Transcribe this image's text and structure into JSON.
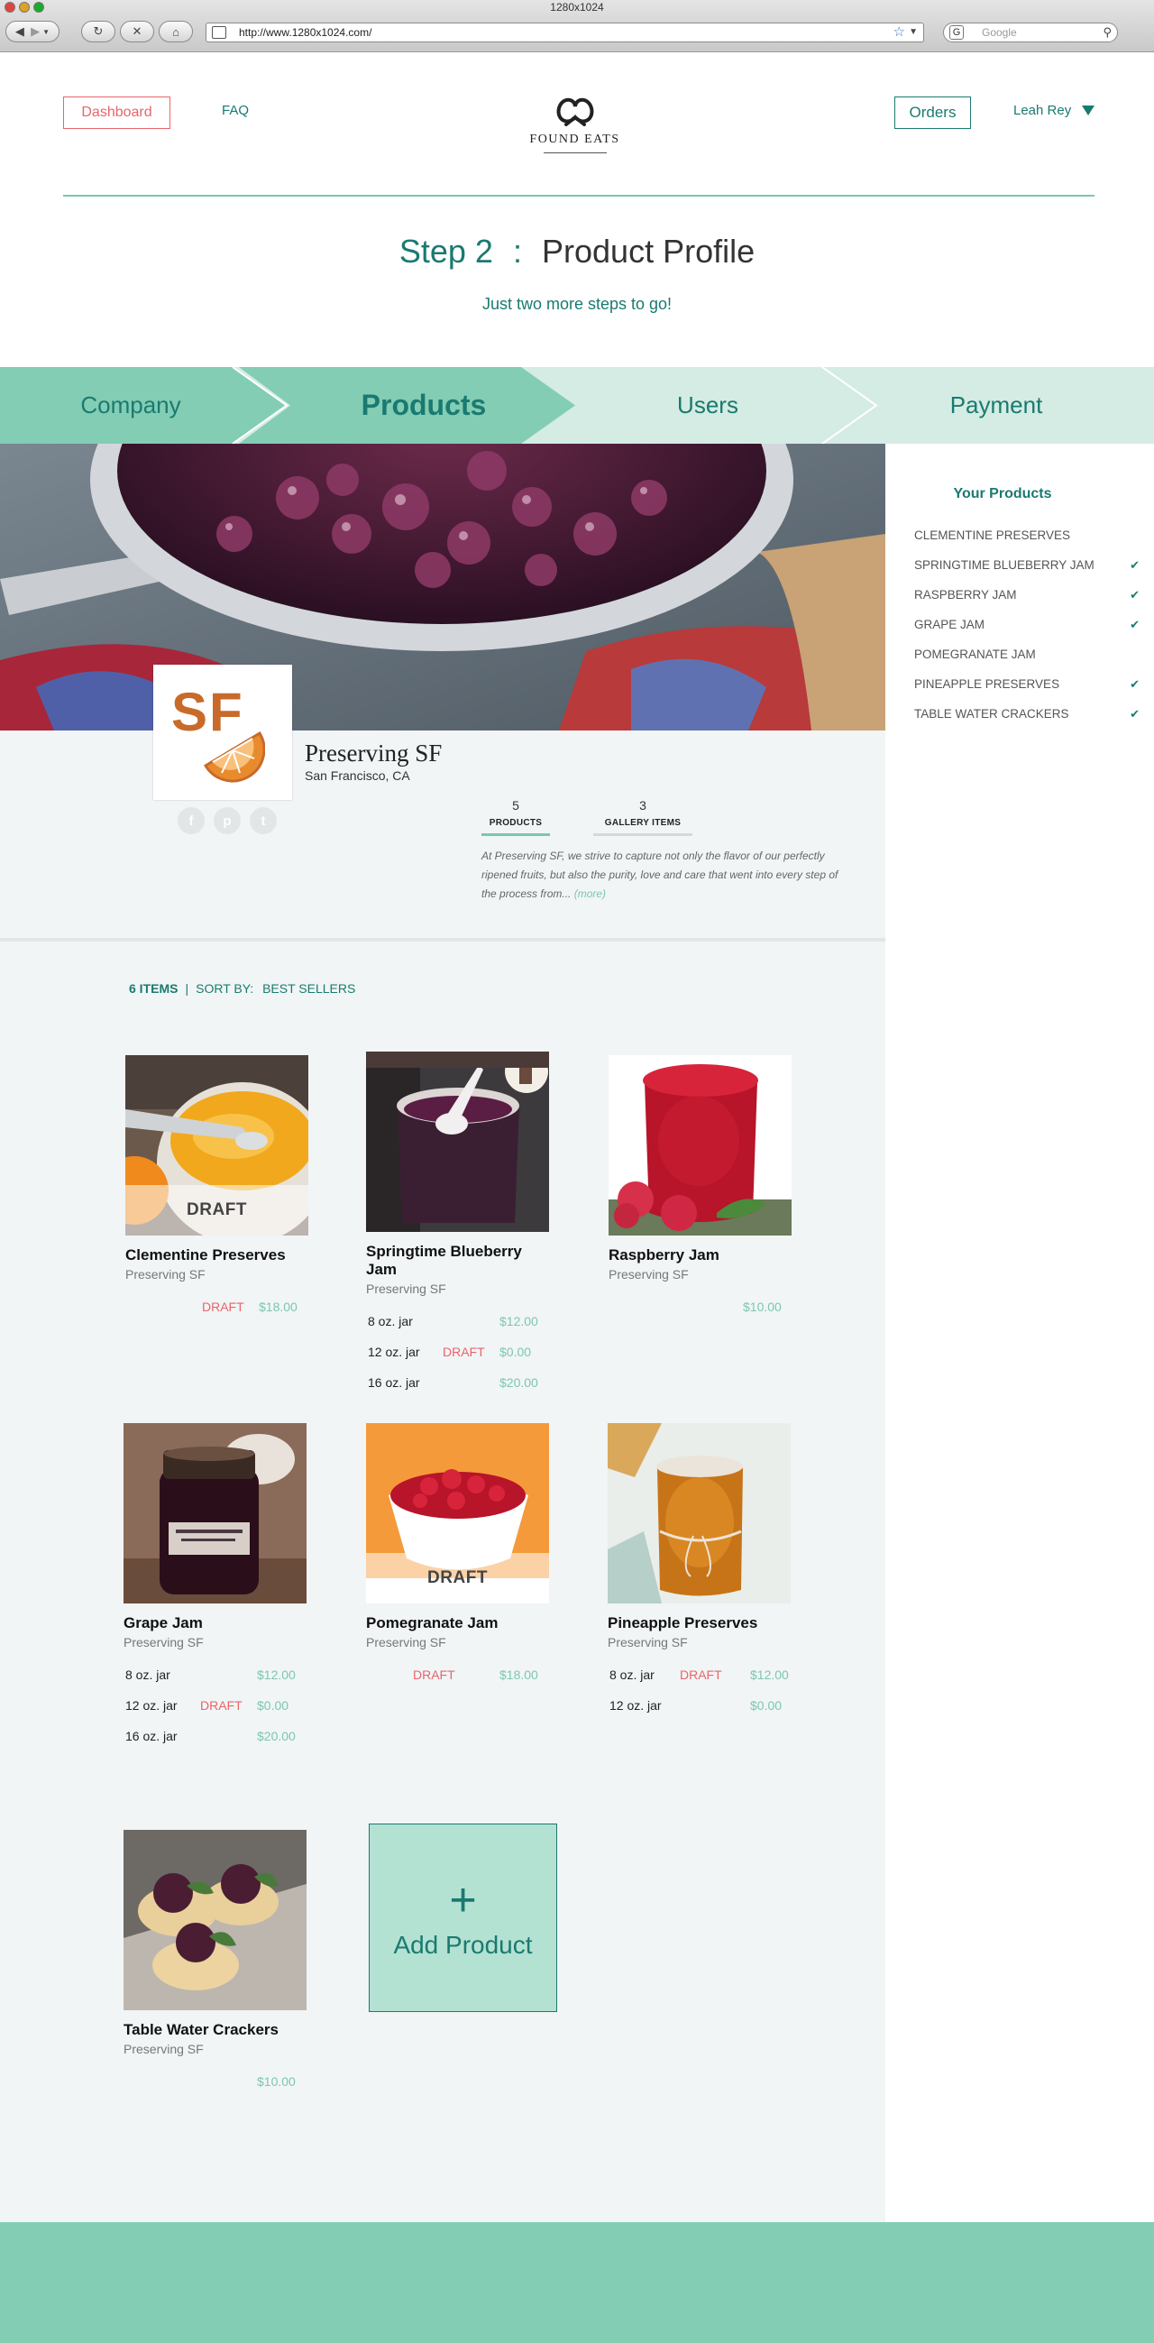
{
  "browser": {
    "window_title": "1280x1024",
    "url": "http://www.1280x1024.com/",
    "search_placeholder": "Google"
  },
  "header": {
    "dashboard_label": "Dashboard",
    "faq_label": "FAQ",
    "brand": "FOUND EATS",
    "orders_label": "Orders",
    "user_name": "Leah Rey"
  },
  "step": {
    "number": "Step 2",
    "separator": ":",
    "name": "Product Profile",
    "subtitle": "Just two more steps to go!"
  },
  "progress": {
    "steps": [
      "Company",
      "Products",
      "Users",
      "Payment"
    ],
    "active_index": 1
  },
  "profile": {
    "logo_text": "SF",
    "company": "Preserving SF",
    "city": "San Francisco, CA",
    "socials": [
      "f",
      "p",
      "t"
    ],
    "stats": [
      {
        "count": "5",
        "label": "PRODUCTS"
      },
      {
        "count": "3",
        "label": "GALLERY ITEMS"
      }
    ],
    "about": "At Preserving SF, we strive to capture not only the flavor of our perfectly ripened fruits, but also the purity, love and care that went into every step of the process from...",
    "more": "(more)"
  },
  "listing": {
    "count_label": "6 ITEMS",
    "sort_label": "SORT BY:",
    "sort_value": "BEST SELLERS"
  },
  "products": [
    {
      "title": "Clementine Preserves",
      "vendor": "Preserving SF",
      "overlay": "DRAFT",
      "rows": [
        {
          "size": "",
          "draft": "DRAFT",
          "price": "$18.00"
        }
      ]
    },
    {
      "title": "Springtime Blueberry Jam",
      "vendor": "Preserving SF",
      "overlay": "",
      "rows": [
        {
          "size": "8 oz.  jar",
          "draft": "",
          "price": "$12.00"
        },
        {
          "size": "12 oz. jar",
          "draft": "DRAFT",
          "price": "$0.00"
        },
        {
          "size": "16 oz.  jar",
          "draft": "",
          "price": "$20.00"
        }
      ]
    },
    {
      "title": "Raspberry Jam",
      "vendor": "Preserving SF",
      "overlay": "",
      "rows": [
        {
          "size": "",
          "draft": "",
          "price": "$10.00"
        }
      ]
    },
    {
      "title": "Grape Jam",
      "vendor": "Preserving SF",
      "overlay": "",
      "rows": [
        {
          "size": "8 oz.  jar",
          "draft": "",
          "price": "$12.00"
        },
        {
          "size": "12 oz. jar",
          "draft": "DRAFT",
          "price": "$0.00"
        },
        {
          "size": "16 oz.  jar",
          "draft": "",
          "price": "$20.00"
        }
      ]
    },
    {
      "title": "Pomegranate Jam",
      "vendor": "Preserving SF",
      "overlay": "DRAFT",
      "rows": [
        {
          "size": "",
          "draft": "DRAFT",
          "price": "$18.00"
        }
      ]
    },
    {
      "title": "Pineapple Preserves",
      "vendor": "Preserving SF",
      "overlay": "",
      "rows": [
        {
          "size": "8 oz.  jar",
          "draft": "DRAFT",
          "price": "$12.00"
        },
        {
          "size": "12 oz. jar",
          "draft": "",
          "price": "$0.00"
        }
      ]
    },
    {
      "title": "Table Water Crackers",
      "vendor": "Preserving SF",
      "overlay": "",
      "rows": [
        {
          "size": "",
          "draft": "",
          "price": "$10.00"
        }
      ]
    }
  ],
  "add_product": {
    "plus": "+",
    "label": "Add Product"
  },
  "sidebar": {
    "title": "Your Products",
    "items": [
      {
        "label": "CLEMENTINE PRESERVES",
        "check": ""
      },
      {
        "label": "SPRINGTIME BLUEBERRY JAM",
        "check": "✔"
      },
      {
        "label": "RASPBERRY JAM",
        "check": "✔"
      },
      {
        "label": "GRAPE JAM",
        "check": "✔"
      },
      {
        "label": "POMEGRANATE JAM",
        "check": ""
      },
      {
        "label": "PINEAPPLE PRESERVES",
        "check": "✔"
      },
      {
        "label": "TABLE WATER CRACKERS",
        "check": "✔"
      }
    ]
  },
  "colors": {
    "teal": "#1a7a70",
    "mint": "#83cdb4",
    "coral": "#e8656a",
    "price": "#7cc6b1"
  }
}
